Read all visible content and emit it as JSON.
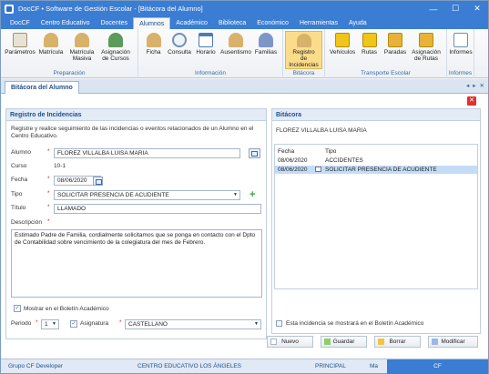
{
  "window": {
    "title": "DocCF • Software de Gestión Escolar - [Bitácora del Alumno]",
    "controls": [
      "—",
      "☐",
      "✕"
    ]
  },
  "menu_tabs": [
    "DocCF",
    "Centro Educativo",
    "Docentes",
    "Alumnos",
    "Académico",
    "Biblioteca",
    "Económico",
    "Herramientas",
    "Ayuda"
  ],
  "active_menu_tab": "Alumnos",
  "ribbon": {
    "groups": [
      {
        "label": "Preparación",
        "buttons": [
          "Parámetros",
          "Matrícula",
          "Matrícula\nMasiva",
          "Asignación\nde Cursos"
        ]
      },
      {
        "label": "Información",
        "buttons": [
          "Ficha",
          "Consulta",
          "Horario",
          "Ausentismo",
          "Familias"
        ]
      },
      {
        "label": "Bitácora",
        "buttons": [
          "Registro de\nIncidencias"
        ]
      },
      {
        "label": "Transporte Escolar",
        "buttons": [
          "Vehículos",
          "Rutas",
          "Paradas",
          "Asignación\nde Rutas"
        ]
      },
      {
        "label": "Informes",
        "buttons": [
          "Informes"
        ]
      }
    ]
  },
  "doc_tab": {
    "label": "Bitácora del Alumno",
    "nav": [
      "◂",
      "▸",
      "✕"
    ]
  },
  "left_panel": {
    "title": "Registro de Incidencias",
    "intro": "Registre y realice seguimiento de las incidencias o eventos relacionados de un Alumno en el Centro Educativo.",
    "alumno_label": "Alumno",
    "alumno_value": "FLOREZ VILLALBA LUISA MARIA",
    "curso_label": "Curso",
    "curso_value": "10-1",
    "fecha_label": "Fecha",
    "fecha_value": "08/06/2020",
    "tipo_label": "Tipo",
    "tipo_value": "SOLICITAR PRESENCIA DE ACUDIENTE",
    "titulo_label": "Título",
    "titulo_value": "LLAMADO",
    "descripcion_label": "Descripción",
    "descripcion_value": "Estimado Padre de Familia, cordialmente solicitamos que se ponga en contacto con el Dpto de Contabilidad sobre vencimiento de la colegiatura del mes de Febrero.",
    "mostrar_label": "Mostrar en el Boletín Académico",
    "periodo_label": "Periodo",
    "periodo_value": "1",
    "asignatura_label": "Asignatura",
    "asignatura_value": "CASTELLANO",
    "required_mark": "*"
  },
  "right_panel": {
    "title": "Bitácora",
    "student": "FLOREZ VILLALBA LUISA MARIA",
    "columns": [
      "Fecha",
      "Tipo"
    ],
    "rows": [
      {
        "fecha": "08/06/2020",
        "tipo": "ACCIDENTES"
      },
      {
        "fecha": "08/06/2020",
        "tipo": "SOLICITAR PRESENCIA DE ACUDIENTE"
      }
    ],
    "footer_note": "Esta incidencia se mostrará en el Boletín Académico"
  },
  "actions": {
    "nuevo": "Nuevo",
    "guardar": "Guardar",
    "borrar": "Borrar",
    "modificar": "Modificar"
  },
  "colors": {
    "nuevo": "#ffffff",
    "guardar": "#8fce6a",
    "borrar": "#f3c440",
    "modificar": "#9cb7e6",
    "accent": "#3a7dd3"
  },
  "statusbar": {
    "group": "Grupo CF Developer",
    "center": "CENTRO EDUCATIVO LOS ÁNGELES",
    "branch": "PRINCIPAL",
    "session": "Ma",
    "cf": "CF"
  }
}
